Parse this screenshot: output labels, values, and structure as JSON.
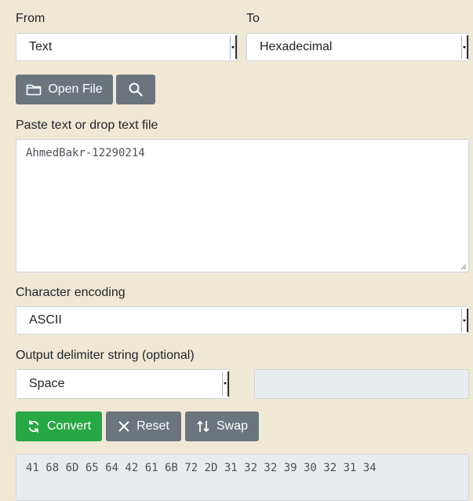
{
  "from": {
    "label": "From",
    "selected": "Text"
  },
  "to": {
    "label": "To",
    "selected": "Hexadecimal"
  },
  "toolbar": {
    "open_file_label": "Open File"
  },
  "input": {
    "label": "Paste text or drop text file",
    "value": "AhmedBakr-12290214"
  },
  "encoding": {
    "label": "Character encoding",
    "selected": "ASCII"
  },
  "delimiter": {
    "label": "Output delimiter string (optional)",
    "selected": "Space",
    "value": ""
  },
  "actions": {
    "convert_label": "Convert",
    "reset_label": "Reset",
    "swap_label": "Swap"
  },
  "output": {
    "value": "41 68 6D 65 64 42 61 6B 72 2D 31 32 32 39 30 32 31 34"
  },
  "colors": {
    "background": "#efe8d5",
    "gray_button": "#6c757d",
    "green_button": "#28a745",
    "readonly_field": "#e9ecef"
  },
  "icons": {
    "open_file": "folder-icon",
    "search": "search-icon",
    "convert": "refresh-icon",
    "reset": "close-icon",
    "swap": "swap-icon"
  }
}
